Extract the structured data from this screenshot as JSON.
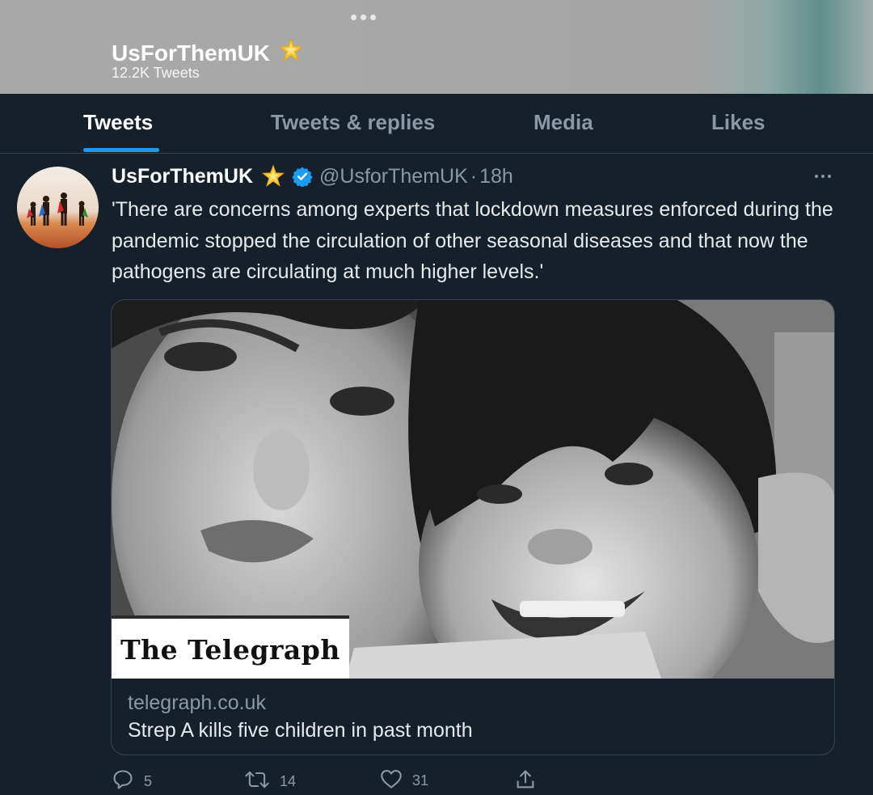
{
  "header": {
    "name": "UsForThemUK",
    "tweet_count": "12.2K Tweets"
  },
  "tabs": [
    {
      "label": "Tweets",
      "active": true
    },
    {
      "label": "Tweets & replies",
      "active": false
    },
    {
      "label": "Media",
      "active": false
    },
    {
      "label": "Likes",
      "active": false
    }
  ],
  "tweet": {
    "name": "UsForThemUK",
    "handle": "@UsforThemUK",
    "separator": "·",
    "time": "18h",
    "text": "'There are concerns among experts that lockdown measures enforced during the pandemic stopped the circulation of other seasonal diseases and that now the pathogens are circulating at much higher levels.'",
    "card": {
      "logo_text": "The Telegraph",
      "domain": "telegraph.co.uk",
      "title": "Strep A kills five children in past month"
    },
    "actions": {
      "replies": "5",
      "retweets": "14",
      "likes": "31"
    }
  },
  "colors": {
    "background": "#15202b",
    "accent": "#1d9bf0",
    "secondary_text": "#8b98a5",
    "border": "#38444d"
  },
  "icons": [
    "star-icon",
    "verified-icon",
    "more-icon",
    "reply-icon",
    "retweet-icon",
    "like-icon",
    "share-icon"
  ]
}
